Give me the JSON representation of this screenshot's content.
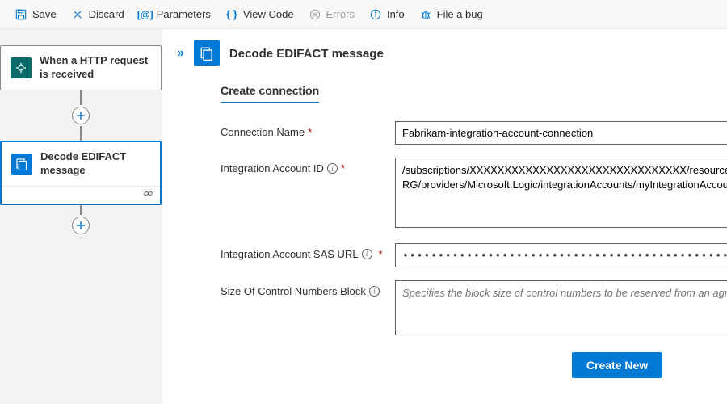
{
  "toolbar": {
    "save": "Save",
    "discard": "Discard",
    "parameters": "Parameters",
    "viewCode": "View Code",
    "errors": "Errors",
    "info": "Info",
    "fileBug": "File a bug"
  },
  "canvas": {
    "trigger": {
      "title": "When a HTTP request is received"
    },
    "action": {
      "title": "Decode EDIFACT message"
    }
  },
  "panel": {
    "title": "Decode EDIFACT message",
    "section": "Create connection",
    "fields": {
      "connectionName": {
        "label": "Connection Name",
        "value": "Fabrikam-integration-account-connection"
      },
      "integrationAccountId": {
        "label": "Integration Account ID",
        "value": "/subscriptions/XXXXXXXXXXXXXXXXXXXXXXXXXXXXXXX/resourceGroups/integrationAccount-RG/providers/Microsoft.Logic/integrationAccounts/myIntegrationAccount"
      },
      "sasUrl": {
        "label": "Integration Account SAS URL",
        "mask": "•••••••••••••••••••••••••••••••••••••••••••••••••••••••••••••••••••••••••••••••••••••"
      },
      "blockSize": {
        "label": "Size Of Control Numbers Block",
        "placeholder": "Specifies the block size of control numbers to be reserved from an agreement. This is intended for high throughput scenarios"
      }
    },
    "createButton": "Create New"
  }
}
